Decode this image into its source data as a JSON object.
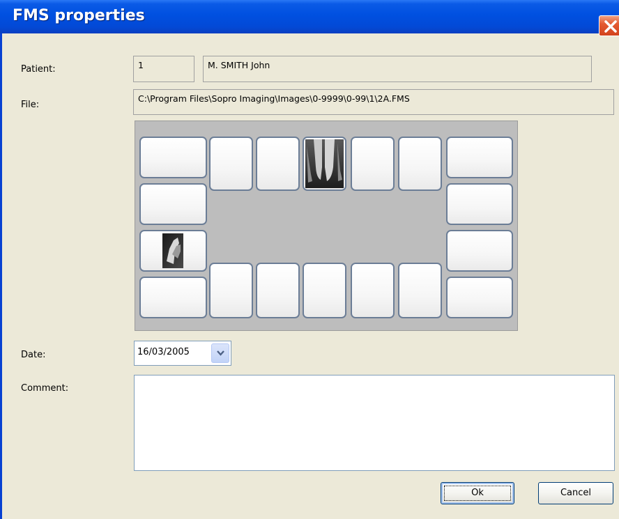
{
  "window": {
    "title": "FMS properties"
  },
  "form": {
    "patient_label": "Patient:",
    "patient_id": "1",
    "patient_name": "M. SMITH John",
    "file_label": "File:",
    "file_path": "C:\\Program Files\\Sopro Imaging\\Images\\0-9999\\0-99\\1\\2A.FMS",
    "date_label": "Date:",
    "date_value": "16/03/2005",
    "comment_label": "Comment:",
    "comment_value": ""
  },
  "fms_board": {
    "slots_total": 20,
    "filled_slots": [
      "top-center",
      "left-third"
    ]
  },
  "buttons": {
    "ok_label": "Ok",
    "cancel_label": "Cancel"
  },
  "colors": {
    "titlebar": "#0050e0",
    "dialog_bg": "#ece9d8",
    "board_bg": "#bdbdbd",
    "slot_border": "#6b7d96",
    "close_button": "#e45a32"
  }
}
